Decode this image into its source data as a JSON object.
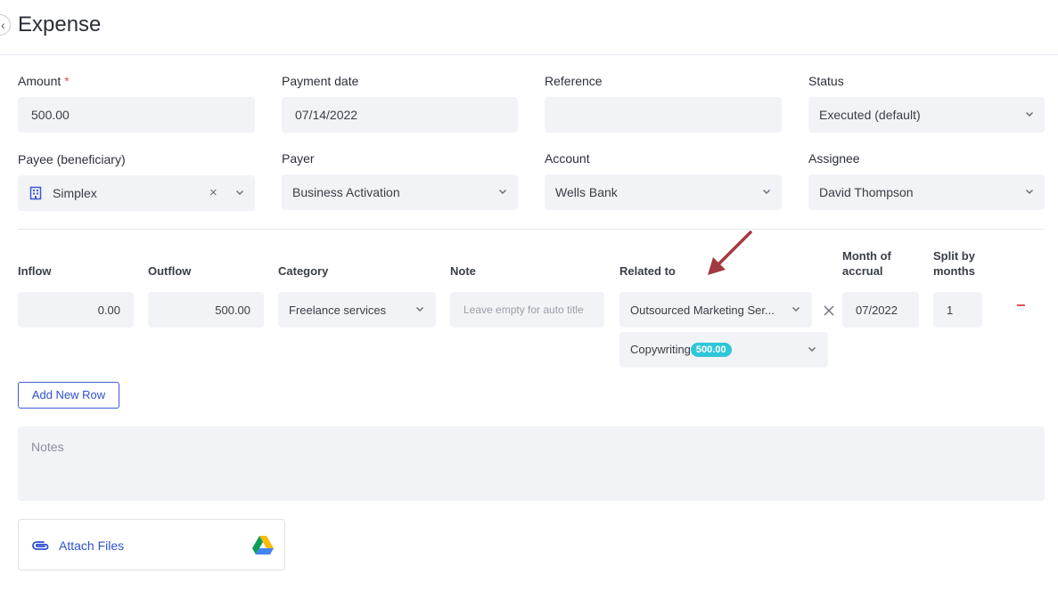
{
  "header": {
    "title": "Expense",
    "back_icon": "chevron-left-icon"
  },
  "top_fields": {
    "amount": {
      "label": "Amount",
      "required_mark": "*",
      "value": "500.00"
    },
    "payment_date": {
      "label": "Payment date",
      "value": "07/14/2022"
    },
    "reference": {
      "label": "Reference",
      "value": ""
    },
    "status": {
      "label": "Status",
      "value": "Executed (default)"
    },
    "payee": {
      "label": "Payee (beneficiary)",
      "value": "Simplex",
      "icon": "building-icon",
      "clear": "×"
    },
    "payer": {
      "label": "Payer",
      "value": "Business Activation"
    },
    "account": {
      "label": "Account",
      "value": "Wells Bank"
    },
    "assignee": {
      "label": "Assignee",
      "value": "David Thompson"
    }
  },
  "rows": {
    "headers": {
      "inflow": "Inflow",
      "outflow": "Outflow",
      "category": "Category",
      "note": "Note",
      "related": "Related to",
      "month": "Month of accrual",
      "split": "Split by months"
    },
    "row": {
      "inflow": "0.00",
      "outflow": "500.00",
      "category": "Freelance services",
      "note_placeholder": "Leave empty for auto title",
      "related": "Outsourced Marketing Ser...",
      "related_sub": "Copywriting",
      "related_sub_badge": "500.00",
      "month": "07/2022",
      "split": "1",
      "remove": "−"
    },
    "add_row_label": "Add New Row"
  },
  "notes": {
    "placeholder": "Notes"
  },
  "attach": {
    "label": "Attach Files",
    "icon": "paperclip-icon",
    "drive_icon": "google-drive-icon"
  },
  "colors": {
    "accent": "#2f4fd1",
    "badge": "#2ec7d8",
    "remove": "#e0505a",
    "annotation_arrow": "#a33a3f",
    "field_bg": "#f2f3f7"
  }
}
